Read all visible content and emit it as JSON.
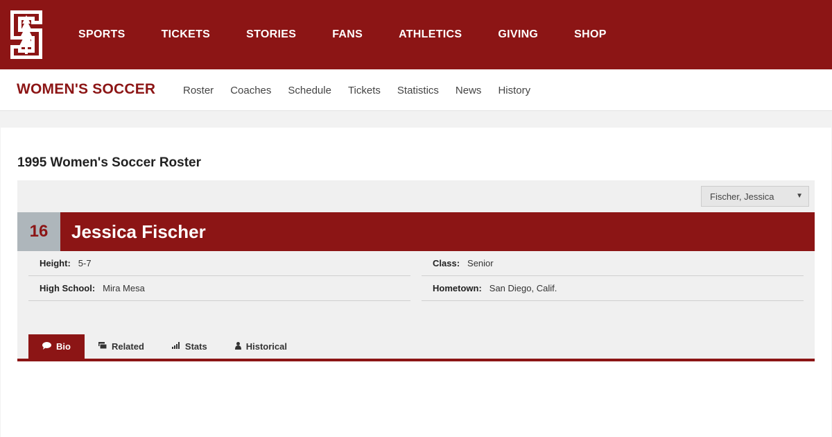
{
  "header": {
    "nav": [
      "SPORTS",
      "TICKETS",
      "STORIES",
      "FANS",
      "ATHLETICS",
      "GIVING",
      "SHOP"
    ],
    "brand_color": "#8c1515"
  },
  "subnav": {
    "sport": "WOMEN'S SOCCER",
    "links": [
      "Roster",
      "Coaches",
      "Schedule",
      "Tickets",
      "Statistics",
      "News",
      "History"
    ]
  },
  "roster": {
    "title": "1995 Women's Soccer Roster",
    "selected_player": "Fischer, Jessica"
  },
  "player": {
    "number": "16",
    "name": "Jessica Fischer",
    "height_label": "Height:",
    "height": "5-7",
    "class_label": "Class:",
    "class": "Senior",
    "high_school_label": "High School:",
    "high_school": "Mira Mesa",
    "hometown_label": "Hometown:",
    "hometown": "San Diego, Calif."
  },
  "tabs": [
    {
      "label": "Bio",
      "icon": "speech-bubble-icon"
    },
    {
      "label": "Related",
      "icon": "cards-icon"
    },
    {
      "label": "Stats",
      "icon": "bar-chart-icon"
    },
    {
      "label": "Historical",
      "icon": "person-icon"
    }
  ]
}
